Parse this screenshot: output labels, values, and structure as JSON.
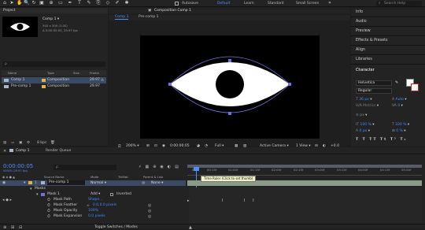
{
  "toolbar": {
    "autokeyframe_label": "Autosave",
    "workspaces": [
      "Default",
      "Learn",
      "Standard",
      "Small Screen"
    ],
    "search_placeholder": "Search Help"
  },
  "project": {
    "tab_label": "Project",
    "comp_name": "Comp 1 ▾",
    "comp_size": "540 x 300 (1.00)",
    "comp_duration": "Δ 0:00:05:05, 29.97 fps",
    "search_placeholder": "ρ",
    "columns": {
      "name": "Name",
      "type": "Type",
      "size": "Size",
      "frame_rate": "Frame Ra..."
    },
    "items": [
      {
        "name": "Comp 1",
        "type": "Composition",
        "frame_rate": "29.97",
        "color": "#e0b24b"
      },
      {
        "name": "Pre-comp 1",
        "type": "Composition",
        "frame_rate": "29.97",
        "color": "#e0b24b"
      }
    ],
    "footer_bpc": "8 bpc"
  },
  "composition": {
    "panel_title": "Composition Comp 1",
    "tabs": [
      "Comp 1",
      "Pre-comp 1"
    ],
    "zoom": "200%",
    "timecode": "0:00:00:05",
    "resolution": "Full",
    "camera": "Active Camera",
    "view": "1 View"
  },
  "right_panel": {
    "items": [
      "Info",
      "Audio",
      "Preview",
      "Effects & Presets",
      "Align",
      "Libraries"
    ],
    "character": {
      "title": "Character",
      "font": "Helvetica",
      "style": "Regular",
      "size": "36 px",
      "leading": "Auto",
      "tracking": "0",
      "kerning_label": "Metrics",
      "stroke": "px",
      "v_scale": "100 %",
      "h_scale": "100 %",
      "baseline": "0 px",
      "tsume": "0 %"
    }
  },
  "timeline": {
    "tab_label": "Comp 1",
    "render_queue": "Render Queue",
    "timecode": "0:00:00:05",
    "timecode_sub": "00005 (29.97 fps)",
    "search_placeholder": "ρ",
    "columns": {
      "source_name": "Source Name",
      "mode": "Mode",
      "trkmat": "TrkMat",
      "parent": "Parent & Link"
    },
    "layer": {
      "index": "1",
      "name": "Pre-comp 1",
      "mode": "Normal",
      "parent": "None"
    },
    "masks_label": "Masks",
    "mask1": {
      "name": "Mask 1",
      "mode": "Add",
      "inverted": "Inverted"
    },
    "props": [
      {
        "name": "Mask Path",
        "value": "Shape..."
      },
      {
        "name": "Mask Feather",
        "value": "0.0,0.0 pixels"
      },
      {
        "name": "Mask Opacity",
        "value": "100%"
      },
      {
        "name": "Mask Expansion",
        "value": "0.0 pixels"
      }
    ],
    "ticks": [
      "00f",
      "00:15f",
      "01:00f",
      "01:15f",
      "02:00f",
      "02:15f",
      "03:00f",
      "03:15f",
      "04:00f",
      "04:15f",
      "05:00f"
    ],
    "tooltip": "Time Ruler (Click to set thumb)",
    "footer": "Toggle Switches / Modes"
  }
}
